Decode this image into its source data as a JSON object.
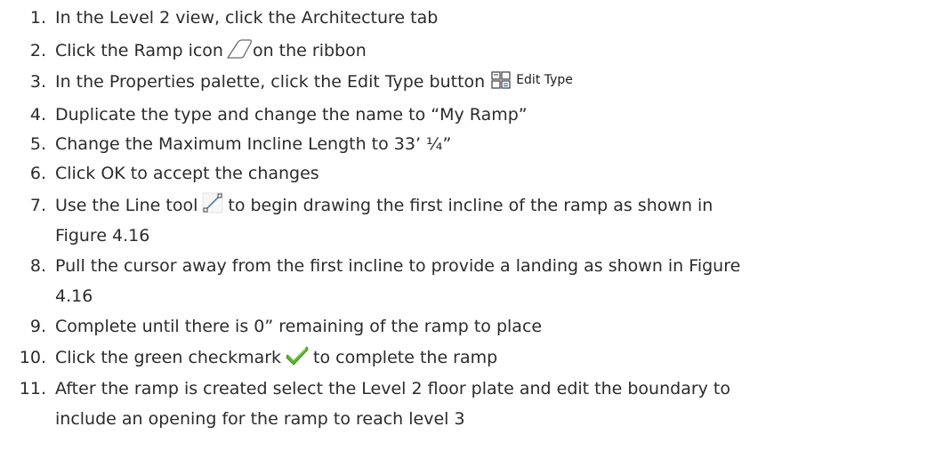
{
  "steps": [
    {
      "num": "1.",
      "text": "In the Level 2 view, click the Architecture tab"
    },
    {
      "num": "2.",
      "text": "Click the Ramp icon",
      "text_after": "on the ribbon",
      "icon": "ramp-icon"
    },
    {
      "num": "3.",
      "text": "In the Properties palette, click the Edit Type button",
      "icon": "edit-type-icon",
      "icon_label": "Edit Type"
    },
    {
      "num": "4.",
      "text": "Duplicate the type and change the name to “My Ramp”"
    },
    {
      "num": "5.",
      "text": "Change the Maximum Incline Length to 33’ ¼”"
    },
    {
      "num": "6.",
      "text": "Click OK to accept the changes"
    },
    {
      "num": "7.",
      "text": "Use the Line tool",
      "text_after": "to begin drawing the first incline of the ramp as shown in",
      "continuation": "Figure 4.16",
      "icon": "line-tool-icon"
    },
    {
      "num": "8.",
      "text": "Pull the cursor away from the first incline to provide a landing as shown in Figure",
      "continuation": "4.16"
    },
    {
      "num": "9.",
      "text": "Complete until there is 0” remaining of the ramp to place"
    },
    {
      "num": "10.",
      "text": "Click the green checkmark",
      "text_after": "to complete the ramp",
      "icon": "green-checkmark-icon"
    },
    {
      "num": "11.",
      "text": "After the ramp is created select the Level 2 floor plate and edit the boundary to",
      "continuation": "include an opening for the ramp to reach level 3"
    }
  ],
  "colors": {
    "text": "#2b2b2b",
    "checkmark": "#5cb82e",
    "icon_stroke": "#6a6a6a"
  }
}
